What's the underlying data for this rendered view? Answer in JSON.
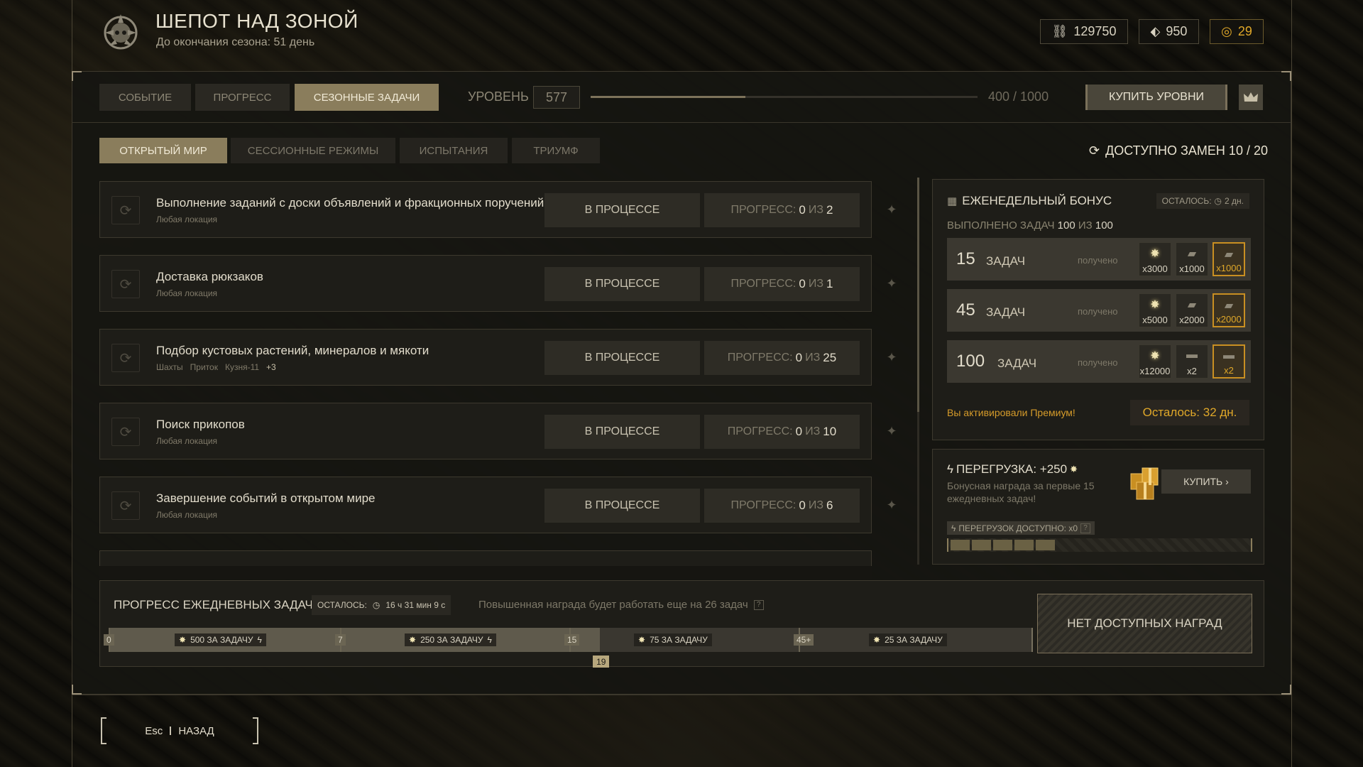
{
  "header": {
    "title": "ШЕПОТ НАД ЗОНОЙ",
    "subtitle": "До окончания сезона: 51 день",
    "currencies": [
      {
        "icon": "coupon-icon",
        "value": "129750"
      },
      {
        "icon": "crystal-icon",
        "value": "950"
      },
      {
        "icon": "coin-icon",
        "value": "29",
        "color": "#e0a829"
      }
    ]
  },
  "tabs": [
    "СОБЫТИЕ",
    "ПРОГРЕСС",
    "СЕЗОННЫЕ ЗАДАЧИ"
  ],
  "level": {
    "label": "УРОВЕНЬ",
    "value": "577",
    "progress_text": "400 / 1000",
    "progress_fraction": 0.4,
    "buy_label": "КУПИТЬ УРОВНИ"
  },
  "subtabs": [
    "ОТКРЫТЫЙ МИР",
    "СЕССИОННЫЕ РЕЖИМЫ",
    "ИСПЫТАНИЯ",
    "ТРИУМФ"
  ],
  "swaps_label": "ДОСТУПНО ЗАМЕН 10 / 20",
  "tasks": [
    {
      "title": "Выполнение заданий с доски объявлений и фракционных поручений",
      "locations": [
        "Любая локация"
      ],
      "status": "В ПРОЦЕССЕ",
      "progress_label": "ПРОГРЕСС:",
      "current": "0",
      "of": "ИЗ",
      "total": "2"
    },
    {
      "title": "Доставка рюкзаков",
      "locations": [
        "Любая локация"
      ],
      "status": "В ПРОЦЕССЕ",
      "progress_label": "ПРОГРЕСС:",
      "current": "0",
      "of": "ИЗ",
      "total": "1"
    },
    {
      "title": "Подбор кустовых растений, минералов и мякоти",
      "locations": [
        "Шахты",
        "Приток",
        "Кузня-11"
      ],
      "more": "+3",
      "status": "В ПРОЦЕССЕ",
      "progress_label": "ПРОГРЕСС:",
      "current": "0",
      "of": "ИЗ",
      "total": "25"
    },
    {
      "title": "Поиск прикопов",
      "locations": [
        "Любая локация"
      ],
      "status": "В ПРОЦЕССЕ",
      "progress_label": "ПРОГРЕСС:",
      "current": "0",
      "of": "ИЗ",
      "total": "10"
    },
    {
      "title": "Завершение событий в открытом мире",
      "locations": [
        "Любая локация"
      ],
      "status": "В ПРОЦЕССЕ",
      "progress_label": "ПРОГРЕСС:",
      "current": "0",
      "of": "ИЗ",
      "total": "6"
    }
  ],
  "weekly": {
    "title": "ЕЖЕНЕДЕЛЬНЫЙ БОНУС",
    "time_left": "ОСТАЛОСЬ:",
    "time_value": "2 дн.",
    "done_label": "ВЫПОЛНЕНО ЗАДАЧ",
    "done_value": "100",
    "done_of": "ИЗ",
    "done_total": "100",
    "tiers": [
      {
        "num": "15",
        "label": "ЗАДАЧ",
        "received": "получено",
        "rewards": [
          {
            "icon": "star-icon",
            "count": "x3000"
          },
          {
            "icon": "plate-icon",
            "count": "x1000"
          },
          {
            "icon": "plate-icon",
            "count": "x1000",
            "premium": true
          }
        ]
      },
      {
        "num": "45",
        "label": "ЗАДАЧ",
        "received": "получено",
        "rewards": [
          {
            "icon": "star-icon",
            "count": "x5000"
          },
          {
            "icon": "plate-icon",
            "count": "x2000"
          },
          {
            "icon": "plate-icon",
            "count": "x2000",
            "premium": true
          }
        ]
      },
      {
        "num": "100",
        "label": "ЗАДАЧ",
        "received": "получено",
        "rewards": [
          {
            "icon": "star-icon",
            "count": "x12000"
          },
          {
            "icon": "case-icon",
            "count": "x2"
          },
          {
            "icon": "case-icon",
            "count": "x2",
            "premium": true
          }
        ]
      }
    ],
    "premium_text": "Вы активировали Премиум!",
    "premium_left": "Осталось: 32 дн."
  },
  "overload": {
    "title": "ПЕРЕГРУЗКА: +250",
    "desc": "Бонусная награда за первые 15 ежедневных задач!",
    "buy_label": "КУПИТЬ",
    "available": "ПЕРЕГРУЗОК ДОСТУПНО: x0",
    "segments_total": 13,
    "segments_filled": 5
  },
  "daily": {
    "title": "ПРОГРЕСС ЕЖЕДНЕВНЫХ ЗАДАЧ",
    "left_label": "ОСТАЛОСЬ:",
    "left_value": "16 ч 31 мин 9 с",
    "note": "Повышенная награда будет работать еще на 26 задач",
    "current": "19",
    "current_value": 19,
    "markers": [
      "0",
      "7",
      "15",
      "45+"
    ],
    "segments": [
      "500 ЗА ЗАДАЧУ",
      "250 ЗА ЗАДАЧУ",
      "75 ЗА ЗАДАЧУ",
      "25 ЗА ЗАДАЧУ"
    ],
    "no_rewards": "НЕТ ДОСТУПНЫХ НАГРАД"
  },
  "back": {
    "key": "Esc",
    "label": "НАЗАД"
  }
}
